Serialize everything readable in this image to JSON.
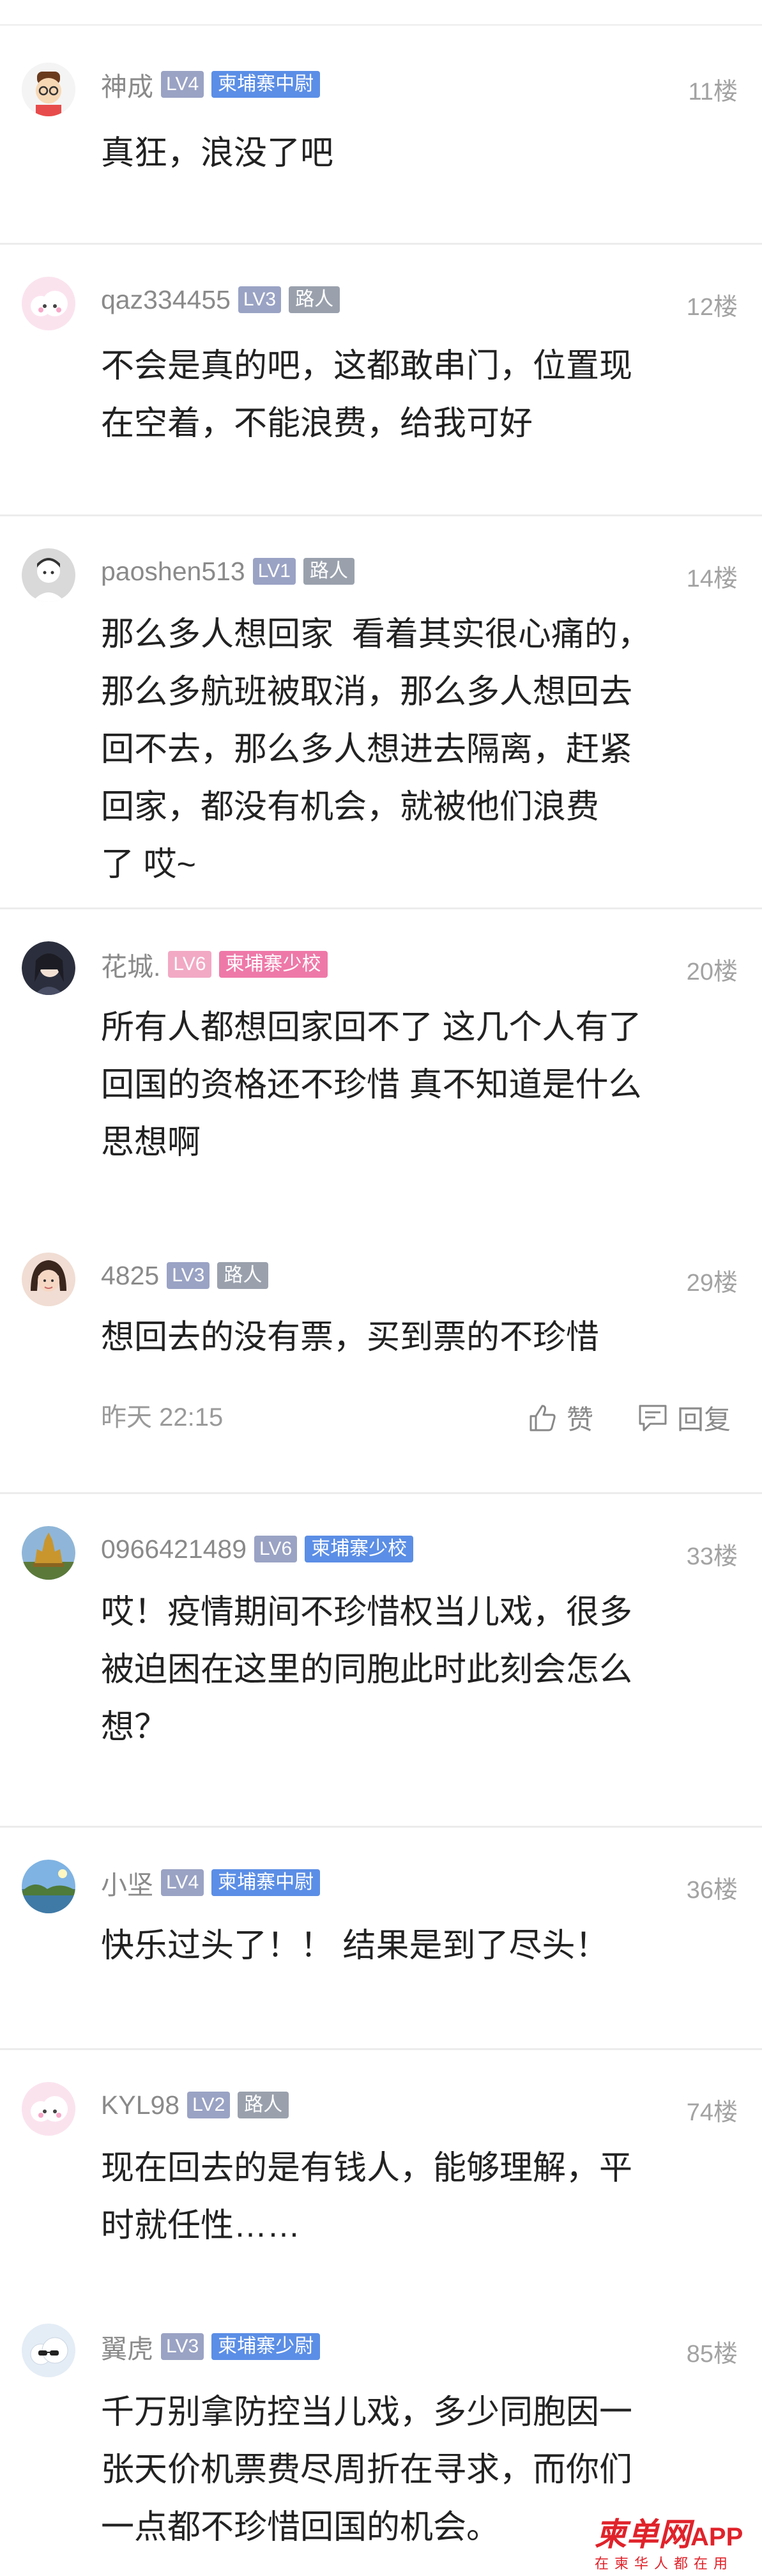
{
  "comments": [
    {
      "user": "神成",
      "level": "LV4",
      "title": "柬埔寨中尉",
      "title_style": "blue",
      "floor": "11楼",
      "text": "真狂，浪没了吧",
      "avatar": "cartoon-boy-glasses-avatar"
    },
    {
      "user": "qaz334455",
      "level": "LV3",
      "title": "路人",
      "title_style": "gray",
      "floor": "12楼",
      "text": "不会是真的吧，这都敢串门，位置现\n在空着，不能浪费，给我可好",
      "avatar": "pink-cloud-avatar"
    },
    {
      "user": "paoshen513",
      "level": "LV1",
      "title": "路人",
      "title_style": "gray",
      "floor": "14楼",
      "text": "那么多人想回家  看着其实很心痛的，\n那么多航班被取消，那么多人想回去\n回不去，那么多人想进去隔离，赶紧\n回家，都没有机会，就被他们浪费\n了 哎~",
      "avatar": "default-person-avatar"
    },
    {
      "user": "花城.",
      "level": "LV6",
      "title": "柬埔寨少校",
      "title_style": "pink",
      "level_style": "pink",
      "floor": "20楼",
      "text": "所有人都想回家回不了 这几个人有了\n回国的资格还不珍惜 真不知道是什么\n思想啊",
      "avatar": "anime-girl-avatar"
    },
    {
      "user": "4825",
      "level": "LV3",
      "title": "路人",
      "title_style": "gray",
      "floor": "29楼",
      "text": "想回去的没有票，买到票的不珍惜",
      "avatar": "photo-woman-avatar",
      "time": "昨天 22:15",
      "like_label": "赞",
      "reply_label": "回复"
    },
    {
      "user": "0966421489",
      "level": "LV6",
      "title": "柬埔寨少校",
      "title_style": "blue",
      "floor": "33楼",
      "text": "哎！疫情期间不珍惜权当儿戏，很多\n被迫困在这里的同胞此时此刻会怎么\n想？",
      "avatar": "temple-photo-avatar"
    },
    {
      "user": "小坚",
      "level": "LV4",
      "title": "柬埔寨中尉",
      "title_style": "blue",
      "floor": "36楼",
      "text": "快乐过头了！！ 结果是到了尽头！",
      "avatar": "landscape-photo-avatar"
    },
    {
      "user": "KYL98",
      "level": "LV2",
      "title": "路人",
      "title_style": "gray",
      "floor": "74楼",
      "text": "现在回去的是有钱人，能够理解，平\n时就任性……",
      "avatar": "pink-cloud-avatar"
    },
    {
      "user": "翼虎",
      "level": "LV3",
      "title": "柬埔寨少尉",
      "title_style": "blue",
      "floor": "85楼",
      "text": "千万别拿防控当儿戏，多少同胞因一\n张天价机票费尽周折在寻求，而你们\n一点都不珍惜回国的机会。",
      "avatar": "cloud-sunglasses-avatar"
    }
  ],
  "watermark": {
    "brand": "柬单网",
    "app": "APP",
    "slogan": "在柬华人都在用"
  },
  "colors": {
    "accent_blue": "#5b8ee6",
    "accent_pink": "#ee79a8",
    "brand_red": "#e0222a"
  }
}
